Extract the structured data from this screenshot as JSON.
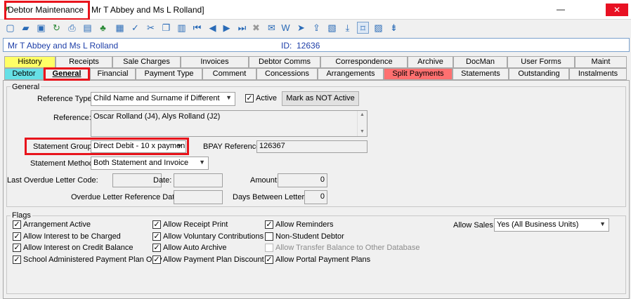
{
  "window": {
    "app_title": "Debtor Maintenance",
    "record_title": "Mr T Abbey and Ms L Rolland]",
    "minimize": "—",
    "close": "✕"
  },
  "header": {
    "name": "Mr T Abbey and Ms L Rolland",
    "id_label": "ID:",
    "id_value": "12636"
  },
  "tabs_row1": [
    "History",
    "Receipts",
    "Sale Charges",
    "Invoices",
    "Debtor Comms",
    "Correspondence",
    "Archive",
    "DocMan",
    "User Forms",
    "Maint"
  ],
  "tabs_row2": [
    "Debtor",
    "General",
    "Financial",
    "Payment Type",
    "Comment",
    "Concessions",
    "Arrangements",
    "Split Payments",
    "Statements",
    "Outstanding",
    "Instalments"
  ],
  "general": {
    "group_title": "General",
    "reference_type_label": "Reference Type:",
    "reference_type_value": "Child Name and Surname if Different",
    "active_label": "Active",
    "active_checked": true,
    "mark_not_active_button": "Mark as NOT Active",
    "reference_label": "Reference:",
    "reference_value": "Oscar Rolland (J4), Alys Rolland (J2)",
    "statement_group_label": "Statement Group:",
    "statement_group_value": "Direct Debit - 10 x paymen",
    "bpay_label": "BPAY Reference:",
    "bpay_value": "126367",
    "statement_method_label": "Statement Method:",
    "statement_method_value": "Both Statement and Invoice",
    "last_overdue_label": "Last Overdue Letter Code:",
    "last_overdue_value": "",
    "date_label": "Date:",
    "date_value": "",
    "amount_label": "Amount:",
    "amount_value": "0",
    "overdue_ref_date_label": "Overdue Letter Reference Date:",
    "overdue_ref_date_value": "",
    "days_between_label": "Days Between Letters:",
    "days_between_value": "0"
  },
  "flags": {
    "group_title": "Flags",
    "col1": [
      {
        "label": "Arrangement Active",
        "checked": true
      },
      {
        "label": "Allow Interest to be Charged",
        "checked": true
      },
      {
        "label": "Allow Interest on Credit Balance",
        "checked": true
      },
      {
        "label": "School Administered Payment Plan Only",
        "checked": true
      }
    ],
    "col2": [
      {
        "label": "Allow Receipt Print",
        "checked": true
      },
      {
        "label": "Allow Voluntary Contributions",
        "checked": true
      },
      {
        "label": "Allow Auto Archive",
        "checked": true
      },
      {
        "label": "Allow Payment Plan Discount",
        "checked": true
      }
    ],
    "col3": [
      {
        "label": "Allow Reminders",
        "checked": true
      },
      {
        "label": "Non-Student Debtor",
        "checked": false
      },
      {
        "label": "Allow Transfer Balance to Other Database",
        "checked": false,
        "disabled": true
      },
      {
        "label": "Allow Portal Payment Plans",
        "checked": true
      }
    ],
    "allow_sales_label": "Allow Sales:",
    "allow_sales_value": "Yes (All Business Units)"
  },
  "colors": {
    "history_tab": "#ffff66",
    "debtor_tab": "#66e0e6",
    "split_payments_tab": "#ff7070",
    "highlight_border": "#e8141c",
    "name_text": "#1e3fa8"
  }
}
